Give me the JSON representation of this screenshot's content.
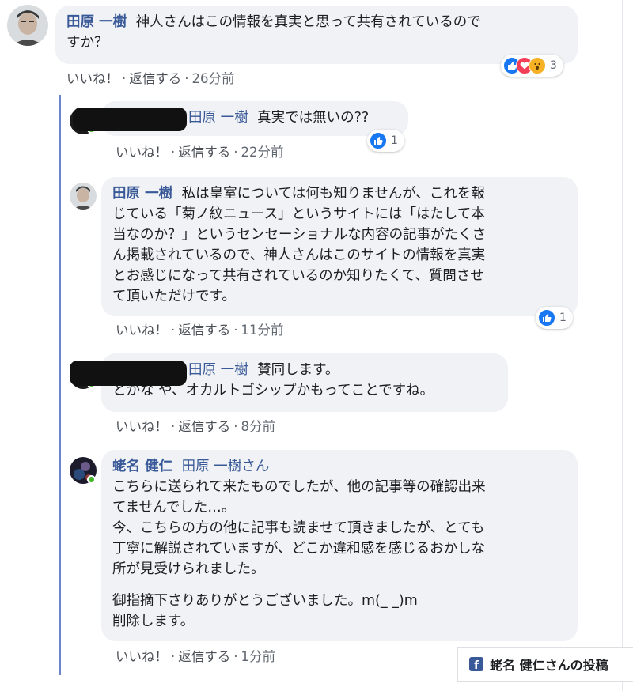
{
  "colors": {
    "author_blue": "#385898",
    "bubble_gray": "#f0f2f5",
    "like_blue": "#1877f2",
    "love_red": "#f33e58",
    "wow_yellow": "#f7b125",
    "online_green": "#42b72a",
    "thread_line": "#6d86c9"
  },
  "actions": {
    "like": "いいね！",
    "reply": "返信する",
    "sep": "·"
  },
  "comments": [
    {
      "author": "田原 一樹",
      "lines": [
        "神人さんはこの情報を真実と思って共有されているので",
        "すか？"
      ],
      "time": "26分前",
      "reactions": {
        "icons": [
          "like-icon",
          "love-icon",
          "wow-icon"
        ],
        "count": "3"
      }
    },
    {
      "author": "",
      "mention": "田原 一樹",
      "lines": [
        "真実では無いの??"
      ],
      "time": "22分前",
      "reactions": {
        "icons": [
          "like-icon"
        ],
        "count": "1"
      }
    },
    {
      "author": "田原 一樹",
      "lines": [
        "私は皇室については何も知りませんが、これを報",
        "じている「菊ノ紋ニュース」というサイトには「はたして本",
        "当なのか？」というセンセーショナルな内容の記事がたくさ",
        "ん掲載されているので、神人さんはこのサイトの情報を真実",
        "とお感じになって共有されているのか知りたくて、質問させ",
        "て頂いただけです。"
      ],
      "time": "11分前",
      "reactions": {
        "icons": [
          "like-icon"
        ],
        "count": "1"
      }
    },
    {
      "author": "",
      "mention": "田原 一樹",
      "lines": [
        "賛同します。",
        "とかな や、オカルトゴシップかもってことですね。"
      ],
      "time": "8分前"
    },
    {
      "author": "蛯名 健仁",
      "mention": "田原 一樹さん",
      "lines": [
        "こちらに送られて来たものでしたが、他の記事等の確認出来",
        "てませんでした…。",
        "今、こちらの方の他に記事も読ませて頂きましたが、とても",
        "丁寧に解説されていますが、どこか違和感を感じるおかしな",
        "所が見受けられました。"
      ],
      "lines2": [
        "御指摘下さりありがとうございました。m(_ _)m",
        "削除します。"
      ],
      "time": "1分前"
    }
  ],
  "footer_chip": {
    "logo_letter": "f",
    "label": "蛯名 健仁さんの投稿"
  }
}
